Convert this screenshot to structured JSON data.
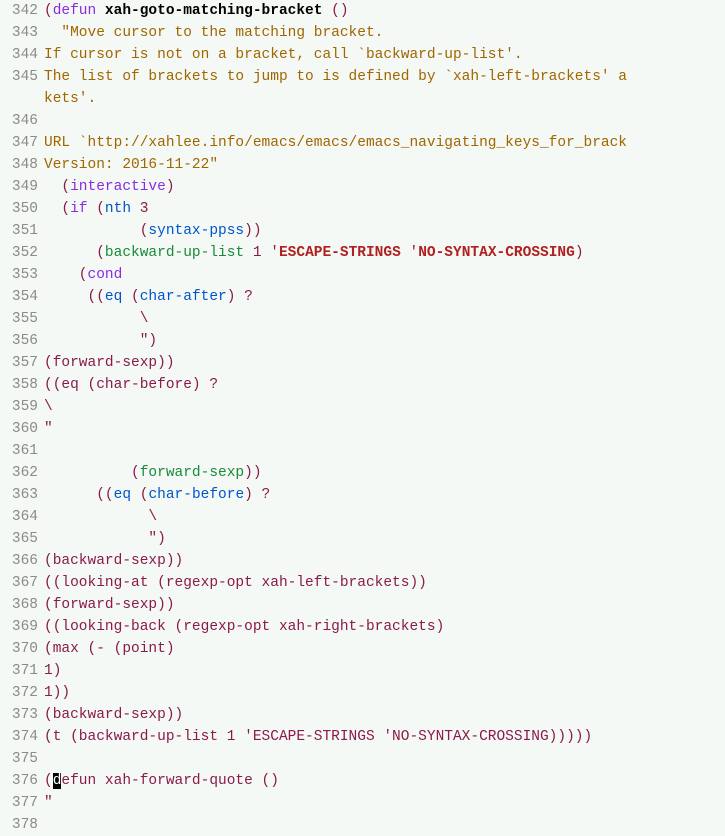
{
  "first_line_number": 342,
  "lines": {
    "342": [
      {
        "t": "(",
        "c": "p-default"
      },
      {
        "t": "defun",
        "c": "kw-defun"
      },
      {
        "t": " ",
        "c": "p-default"
      },
      {
        "t": "xah-goto-matching-bracket",
        "c": "fn-name"
      },
      {
        "t": " ()",
        "c": "p-default"
      }
    ],
    "343": [
      {
        "t": "  ",
        "c": "p-default"
      },
      {
        "t": "\"Move cursor to the matching bracket.",
        "c": "string"
      }
    ],
    "344": [
      {
        "t": "If cursor is not on a bracket, call `backward-up-list'.",
        "c": "string"
      }
    ],
    "345": [
      {
        "t": "The list of brackets to jump to is defined by `xah-left-brackets' a",
        "c": "string"
      }
    ],
    "345b": [
      {
        "t": "kets'.",
        "c": "string"
      }
    ],
    "346": [],
    "347": [
      {
        "t": "URL `http://xahlee.info/emacs/emacs/emacs_navigating_keys_for_brack",
        "c": "string"
      }
    ],
    "348": [
      {
        "t": "Version: 2016-11-22\"",
        "c": "string"
      }
    ],
    "349": [
      {
        "t": "  (",
        "c": "p-default"
      },
      {
        "t": "interactive",
        "c": "kw-interactive"
      },
      {
        "t": ")",
        "c": "p-default"
      }
    ],
    "350": [
      {
        "t": "  (",
        "c": "p-default"
      },
      {
        "t": "if",
        "c": "kw-if"
      },
      {
        "t": " (",
        "c": "p-default"
      },
      {
        "t": "nth",
        "c": "fn-call"
      },
      {
        "t": " 3",
        "c": "p-default"
      }
    ],
    "351": [
      {
        "t": "           (",
        "c": "p-default"
      },
      {
        "t": "syntax-ppss",
        "c": "fn-call"
      },
      {
        "t": "))",
        "c": "p-default"
      }
    ],
    "352": [
      {
        "t": "      (",
        "c": "p-default"
      },
      {
        "t": "backward-up-list",
        "c": "fn-green"
      },
      {
        "t": " 1 '",
        "c": "p-default"
      },
      {
        "t": "ESCAPE-STRINGS",
        "c": "sym-bold"
      },
      {
        "t": " '",
        "c": "p-default"
      },
      {
        "t": "NO-SYNTAX-CROSSING",
        "c": "sym-bold"
      },
      {
        "t": ")",
        "c": "p-default"
      }
    ],
    "353": [
      {
        "t": "    (",
        "c": "p-default"
      },
      {
        "t": "cond",
        "c": "kw-cond"
      }
    ],
    "354": [
      {
        "t": "     ((",
        "c": "p-default"
      },
      {
        "t": "eq",
        "c": "fn-call"
      },
      {
        "t": " (",
        "c": "p-default"
      },
      {
        "t": "char-after",
        "c": "fn-call"
      },
      {
        "t": ") ?",
        "c": "p-default"
      }
    ],
    "355": [
      {
        "t": "           \\",
        "c": "p-default"
      }
    ],
    "356": [
      {
        "t": "           \")",
        "c": "p-default"
      }
    ],
    "357": [
      {
        "t": "(forward-sexp))",
        "c": "p-default"
      }
    ],
    "358": [
      {
        "t": "((eq (char-before) ?",
        "c": "p-default"
      }
    ],
    "359": [
      {
        "t": "\\",
        "c": "p-default"
      }
    ],
    "360": [
      {
        "t": "\"",
        "c": "p-default"
      }
    ],
    "361": [],
    "362": [
      {
        "t": "          (",
        "c": "p-default"
      },
      {
        "t": "forward-sexp",
        "c": "fn-green"
      },
      {
        "t": "))",
        "c": "p-default"
      }
    ],
    "363": [
      {
        "t": "      ((",
        "c": "p-default"
      },
      {
        "t": "eq",
        "c": "fn-call"
      },
      {
        "t": " (",
        "c": "p-default"
      },
      {
        "t": "char-before",
        "c": "fn-call"
      },
      {
        "t": ") ?",
        "c": "p-default"
      }
    ],
    "364": [
      {
        "t": "            \\",
        "c": "p-default"
      }
    ],
    "365": [
      {
        "t": "            \")",
        "c": "p-default"
      }
    ],
    "366": [
      {
        "t": "(backward-sexp))",
        "c": "p-default"
      }
    ],
    "367": [
      {
        "t": "((looking-at (regexp-opt xah-left-brackets))",
        "c": "p-default"
      }
    ],
    "368": [
      {
        "t": "(forward-sexp))",
        "c": "p-default"
      }
    ],
    "369": [
      {
        "t": "((looking-back (regexp-opt xah-right-brackets)",
        "c": "p-default"
      }
    ],
    "370": [
      {
        "t": "(max (- (point)",
        "c": "p-default"
      }
    ],
    "371": [
      {
        "t": "1)",
        "c": "p-default"
      }
    ],
    "372": [
      {
        "t": "1))",
        "c": "p-default"
      }
    ],
    "373": [
      {
        "t": "(backward-sexp))",
        "c": "p-default"
      }
    ],
    "374": [
      {
        "t": "(t (backward-up-list 1 'ESCAPE-STRINGS 'NO-SYNTAX-CROSSING)))))",
        "c": "p-default"
      }
    ],
    "375": [],
    "376": [
      {
        "t": "(",
        "c": "p-default"
      },
      {
        "t": "d",
        "c": "cursor",
        "name": "cursor"
      },
      {
        "t": "efun xah-forward-quote ()",
        "c": "p-default"
      }
    ],
    "377": [
      {
        "t": "\"",
        "c": "p-default"
      }
    ],
    "378": []
  },
  "line_order": [
    "342",
    "343",
    "344",
    "345",
    "345b",
    "346",
    "347",
    "348",
    "349",
    "350",
    "351",
    "352",
    "353",
    "354",
    "355",
    "356",
    "357",
    "358",
    "359",
    "360",
    "361",
    "362",
    "363",
    "364",
    "365",
    "366",
    "367",
    "368",
    "369",
    "370",
    "371",
    "372",
    "373",
    "374",
    "375",
    "376",
    "377",
    "378"
  ],
  "line_numbers_display": {
    "342": "342",
    "343": "343",
    "344": "344",
    "345": "345",
    "345b": "",
    "346": "346",
    "347": "347",
    "348": "348",
    "349": "349",
    "350": "350",
    "351": "351",
    "352": "352",
    "353": "353",
    "354": "354",
    "355": "355",
    "356": "356",
    "357": "357",
    "358": "358",
    "359": "359",
    "360": "360",
    "361": "361",
    "362": "362",
    "363": "363",
    "364": "364",
    "365": "365",
    "366": "366",
    "367": "367",
    "368": "368",
    "369": "369",
    "370": "370",
    "371": "371",
    "372": "372",
    "373": "373",
    "374": "374",
    "375": "375",
    "376": "376",
    "377": "377",
    "378": "378"
  }
}
